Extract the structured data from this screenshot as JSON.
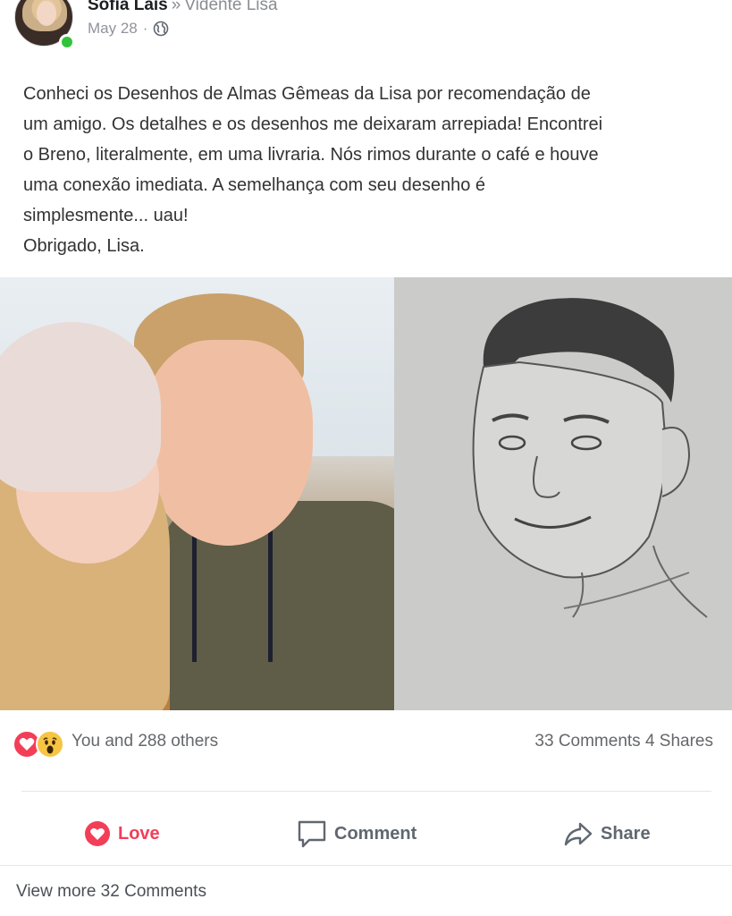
{
  "header": {
    "author_name": "Sofia Lais",
    "separator": "»",
    "target_name": "Vidente Lisa",
    "date": "May 28",
    "date_dot": "·",
    "privacy_icon": "globe-icon",
    "online_color": "#31c43a"
  },
  "post": {
    "lines": [
      "Conheci os Desenhos de Almas Gêmeas da Lisa por recomendação de",
      "um amigo. Os detalhes e os desenhos me deixaram arrepiada! Encontrei",
      "o Breno, literalmente, em uma livraria. Nós rimos durante o café e houve",
      "uma conexão imediata. A semelhança com seu desenho é",
      "simplesmente... uau!",
      "Obrigado, Lisa."
    ]
  },
  "reactions": {
    "icons": [
      "love-reaction-icon",
      "wow-reaction-icon"
    ],
    "summary": "You and 288 others",
    "counts": "33 Comments 4 Shares",
    "love_color": "#f33e58",
    "wow_color": "#f7c544"
  },
  "actions": {
    "love_label": "Love",
    "comment_label": "Comment",
    "share_label": "Share"
  },
  "footer": {
    "view_more": "View more 32 Comments"
  }
}
